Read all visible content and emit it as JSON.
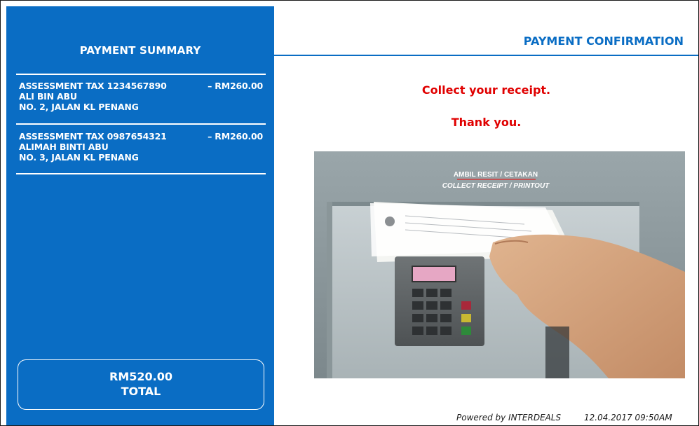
{
  "summary": {
    "title": "PAYMENT SUMMARY",
    "items": [
      {
        "label": "ASSESSMENT TAX 1234567890",
        "amount": "– RM260.00",
        "name": "ALI BIN ABU",
        "address": "NO. 2, JALAN KL PENANG"
      },
      {
        "label": "ASSESSMENT TAX 0987654321",
        "amount": "– RM260.00",
        "name": "ALIMAH BINTI ABU",
        "address": "NO. 3, JALAN KL PENANG"
      }
    ],
    "total_amount": "RM520.00",
    "total_label": "TOTAL"
  },
  "confirmation": {
    "title": "PAYMENT CONFIRMATION",
    "message_1": "Collect your receipt.",
    "message_2": "Thank you."
  },
  "photo": {
    "sign_line_1": "AMBIL RESIT / CETAKAN",
    "sign_line_2": "COLLECT RECEIPT / PRINTOUT"
  },
  "footer": {
    "powered_by": "Powered by INTERDEALS",
    "datetime": "12.04.2017  09:50AM"
  },
  "colors": {
    "brand_blue": "#0a6dc4",
    "alert_red": "#e00000"
  }
}
